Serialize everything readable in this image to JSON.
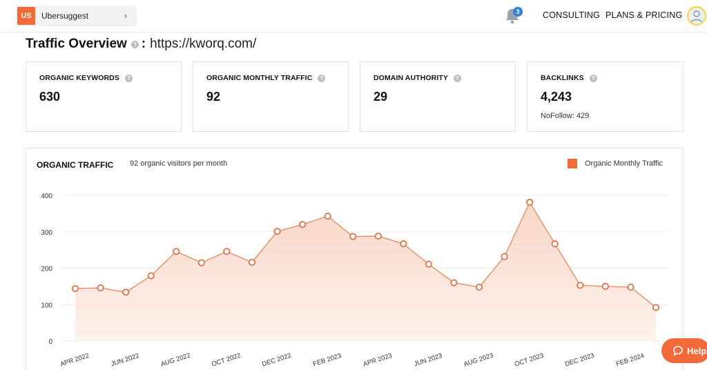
{
  "header": {
    "logo_text": "US",
    "project_name": "Ubersuggest",
    "notification_count": "3",
    "nav": {
      "consulting": "CONSULTING",
      "plans": "PLANS & PRICING"
    }
  },
  "overview": {
    "title": "Traffic Overview",
    "separator": ":",
    "domain": "https://kworq.com/"
  },
  "cards": [
    {
      "label": "ORGANIC KEYWORDS",
      "value": "630"
    },
    {
      "label": "ORGANIC MONTHLY TRAFFIC",
      "value": "92"
    },
    {
      "label": "DOMAIN AUTHORITY",
      "value": "29"
    },
    {
      "label": "BACKLINKS",
      "value": "4,243",
      "sub": "NoFollow: 429"
    }
  ],
  "traffic_panel": {
    "title": "ORGANIC TRAFFIC",
    "subtitle": "92 organic visitors per month",
    "legend_label": "Organic Monthly Traffic"
  },
  "help_label": "Help",
  "colors": {
    "accent": "#f26a3a",
    "line": "#e08a5c",
    "badge": "#3a7dd8"
  },
  "icons": [
    "bell-icon",
    "chevron-right-icon",
    "info-icon",
    "user-icon",
    "chat-icon"
  ],
  "chart_data": {
    "type": "area",
    "x": [
      "APR 2022",
      "MAY 2022",
      "JUN 2022",
      "JUL 2022",
      "AUG 2022",
      "SEP 2022",
      "OCT 2022",
      "NOV 2022",
      "DEC 2022",
      "JAN 2023",
      "FEB 2023",
      "MAR 2023",
      "APR 2023",
      "MAY 2023",
      "JUN 2023",
      "JUL 2023",
      "AUG 2023",
      "SEP 2023",
      "OCT 2023",
      "NOV 2023",
      "DEC 2023",
      "JAN 2024",
      "FEB 2024",
      "MAR 2024"
    ],
    "x_tick_labels": [
      "APR 2022",
      "JUN 2022",
      "AUG 2022",
      "OCT 2022",
      "DEC 2022",
      "FEB 2023",
      "APR 2023",
      "JUN 2023",
      "AUG 2023",
      "OCT 2023",
      "DEC 2023",
      "FEB 2024"
    ],
    "series": [
      {
        "name": "Organic Monthly Traffic",
        "values": [
          144,
          146,
          134,
          179,
          246,
          215,
          246,
          216,
          301,
          320,
          343,
          287,
          288,
          267,
          211,
          160,
          148,
          232,
          381,
          267,
          153,
          150,
          148,
          92
        ]
      }
    ],
    "ylim": [
      0,
      400
    ],
    "yticks": [
      0,
      100,
      200,
      300,
      400
    ],
    "grid": true,
    "legend": "top-right"
  }
}
